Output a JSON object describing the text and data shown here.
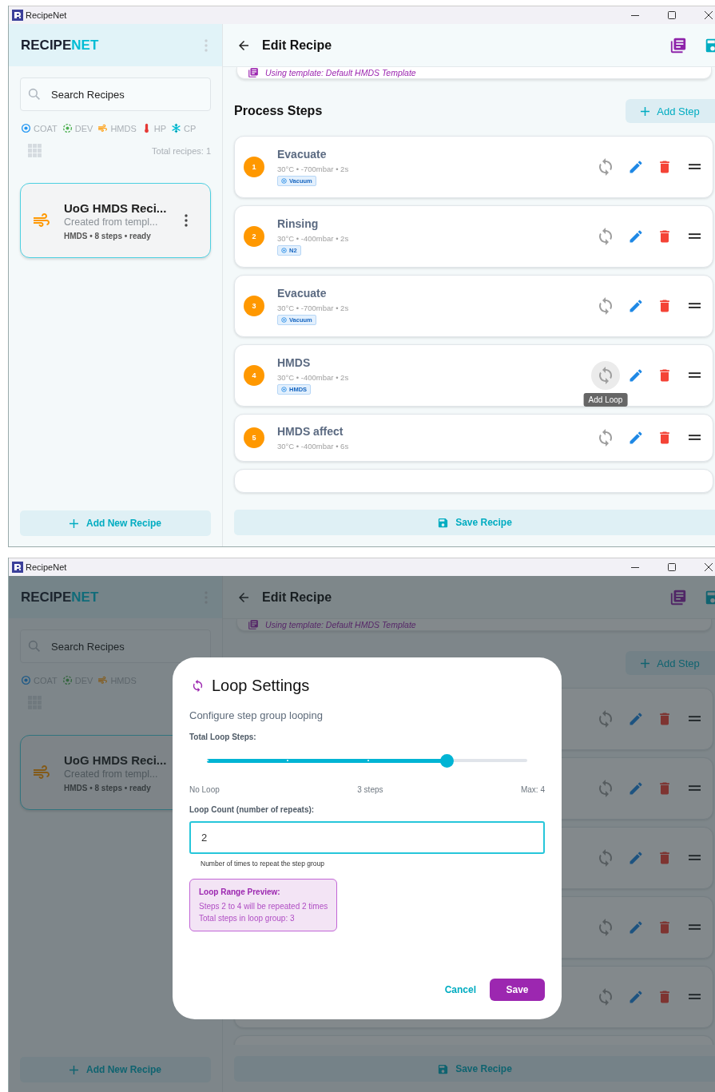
{
  "screens": [
    {
      "window": {
        "title": "RecipeNet"
      },
      "sidebar": {
        "logo": [
          {
            "text": "RECIPE",
            "accent": false
          },
          {
            "text": "NET",
            "accent": true
          }
        ],
        "search": {
          "placeholder": "Search Recipes"
        },
        "filters": [
          {
            "kind": "coat",
            "label": "COAT"
          },
          {
            "kind": "dev",
            "label": "DEV"
          },
          {
            "kind": "hmds",
            "label": "HMDS"
          },
          {
            "kind": "hp",
            "label": "HP"
          },
          {
            "kind": "cp",
            "label": "CP"
          }
        ],
        "total": "Total recipes: 1",
        "recipes": [
          {
            "name": "UoG HMDS Reci...",
            "description": "Created from templ...",
            "meta": "HMDS • 8 steps • ready",
            "selected": true,
            "menu": true
          }
        ],
        "add_button": "Add New Recipe"
      },
      "header": {
        "title": "Edit Recipe"
      },
      "template_note": "Using template: Default HMDS Template",
      "steps_section": {
        "title": "Process Steps",
        "add_button": "Add Step"
      },
      "steps": [
        {
          "kind": "step",
          "number": "1",
          "name": "Evacuate",
          "details": "30°C • -700mbar • 2s",
          "tag": "Vacuum"
        },
        {
          "kind": "step",
          "number": "2",
          "name": "Rinsing",
          "details": "30°C • -400mbar • 2s",
          "tag": "N2"
        },
        {
          "kind": "step",
          "number": "3",
          "name": "Evacuate",
          "details": "30°C • -700mbar • 2s",
          "tag": "Vacuum"
        },
        {
          "kind": "step",
          "number": "4",
          "name": "HMDS",
          "details": "30°C • -400mbar • 2s",
          "tag": "HMDS",
          "tooltip": "Add Loop"
        },
        {
          "kind": "step",
          "number": "5",
          "name": "HMDS affect",
          "details": "30°C • -400mbar • 6s"
        }
      ],
      "save_button": "Save Recipe"
    },
    {
      "window": {
        "title": "RecipeNet"
      },
      "sidebar": {
        "logo": [
          {
            "text": "RECIPE",
            "accent": false
          },
          {
            "text": "NET",
            "accent": true
          }
        ],
        "search": {
          "placeholder": "Search Recipes"
        },
        "filters": [
          {
            "kind": "coat",
            "label": "COAT"
          },
          {
            "kind": "dev",
            "label": "DEV"
          },
          {
            "kind": "hmds",
            "label": "HMDS"
          }
        ],
        "recipes": [
          {
            "name": "UoG HMDS Reci...",
            "description": "Created from templ...",
            "meta": "HMDS • 8 steps • ready",
            "selected": true
          }
        ],
        "add_button": "Add New Recipe"
      },
      "header": {
        "title": "Edit Recipe"
      },
      "template_note": "Using template: Default HMDS Template",
      "steps_section": {
        "add_button": "Add Step"
      },
      "steps": [
        {
          "kind": "covered"
        },
        {
          "kind": "covered"
        },
        {
          "kind": "covered"
        },
        {
          "kind": "covered"
        },
        {
          "kind": "covered"
        }
      ],
      "save_button": "Save Recipe",
      "dialog": {
        "title": "Loop Settings",
        "subtitle": "Configure step group looping",
        "slider_label": "Total Loop Steps:",
        "slider": {
          "level": 0.75,
          "min_label": "No Loop",
          "value_label": "3 steps",
          "max_label": "Max: 4"
        },
        "count_label": "Loop Count (number of repeats):",
        "count_value": "2",
        "count_helper": "Number of times to repeat the step group",
        "preview": {
          "title": "Loop Range Preview:",
          "lines": [
            "Steps 2 to 4 will be repeated 2 times",
            "Total steps in loop group: 3"
          ]
        },
        "buttons": [
          {
            "kind": "text",
            "label": "Cancel"
          },
          {
            "kind": "primary",
            "label": "Save"
          }
        ]
      }
    }
  ]
}
